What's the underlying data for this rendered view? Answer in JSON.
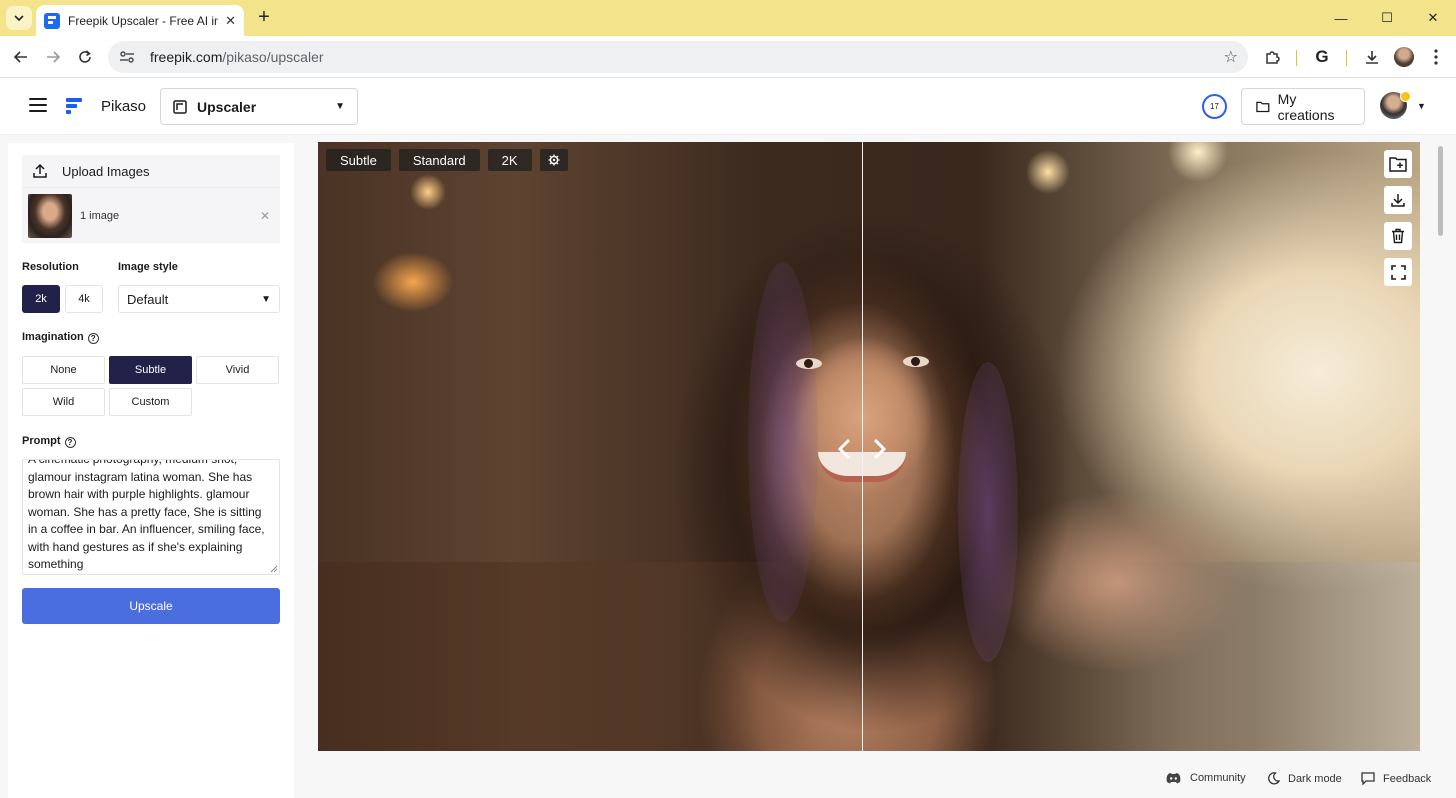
{
  "browser": {
    "tab_title": "Freepik Upscaler - Free AI image upscaler",
    "new_tab_label": "+",
    "url_host": "freepik.com",
    "url_path": "/pikaso/upscaler",
    "window_minimize": "—",
    "window_maximize": "☐",
    "window_close": "✕",
    "tab_close": "✕"
  },
  "header": {
    "brand": "Pikaso",
    "tool_label": "Upscaler",
    "credits": "17",
    "my_creations": "My creations"
  },
  "sidebar": {
    "upload_label": "Upload Images",
    "image_count": "1 image",
    "resolution_label": "Resolution",
    "resolution_options": [
      "2k",
      "4k"
    ],
    "resolution_selected": "2k",
    "image_style_label": "Image style",
    "image_style_value": "Default",
    "imagination_label": "Imagination",
    "imagination_options": [
      "None",
      "Subtle",
      "Vivid",
      "Wild",
      "Custom"
    ],
    "imagination_selected": "Subtle",
    "prompt_label": "Prompt",
    "prompt_text": "A cinematic photography, medium shot, glamour instagram latina woman. She has brown hair with purple highlights. glamour woman. She has a pretty face, She is sitting in a coffee in bar. An influencer, smiling face, with hand gestures as if she's explaining something",
    "upscale_button": "Upscale"
  },
  "viewer": {
    "chips": [
      "Subtle",
      "Standard",
      "2K"
    ],
    "compare_split": 0.494
  },
  "footer": {
    "community": "Community",
    "dark_mode": "Dark mode",
    "feedback": "Feedback"
  },
  "colors": {
    "accent": "#4a6ee0",
    "selected": "#22214a",
    "brand": "#1b5ef5",
    "tabbar": "#f3e38a"
  }
}
